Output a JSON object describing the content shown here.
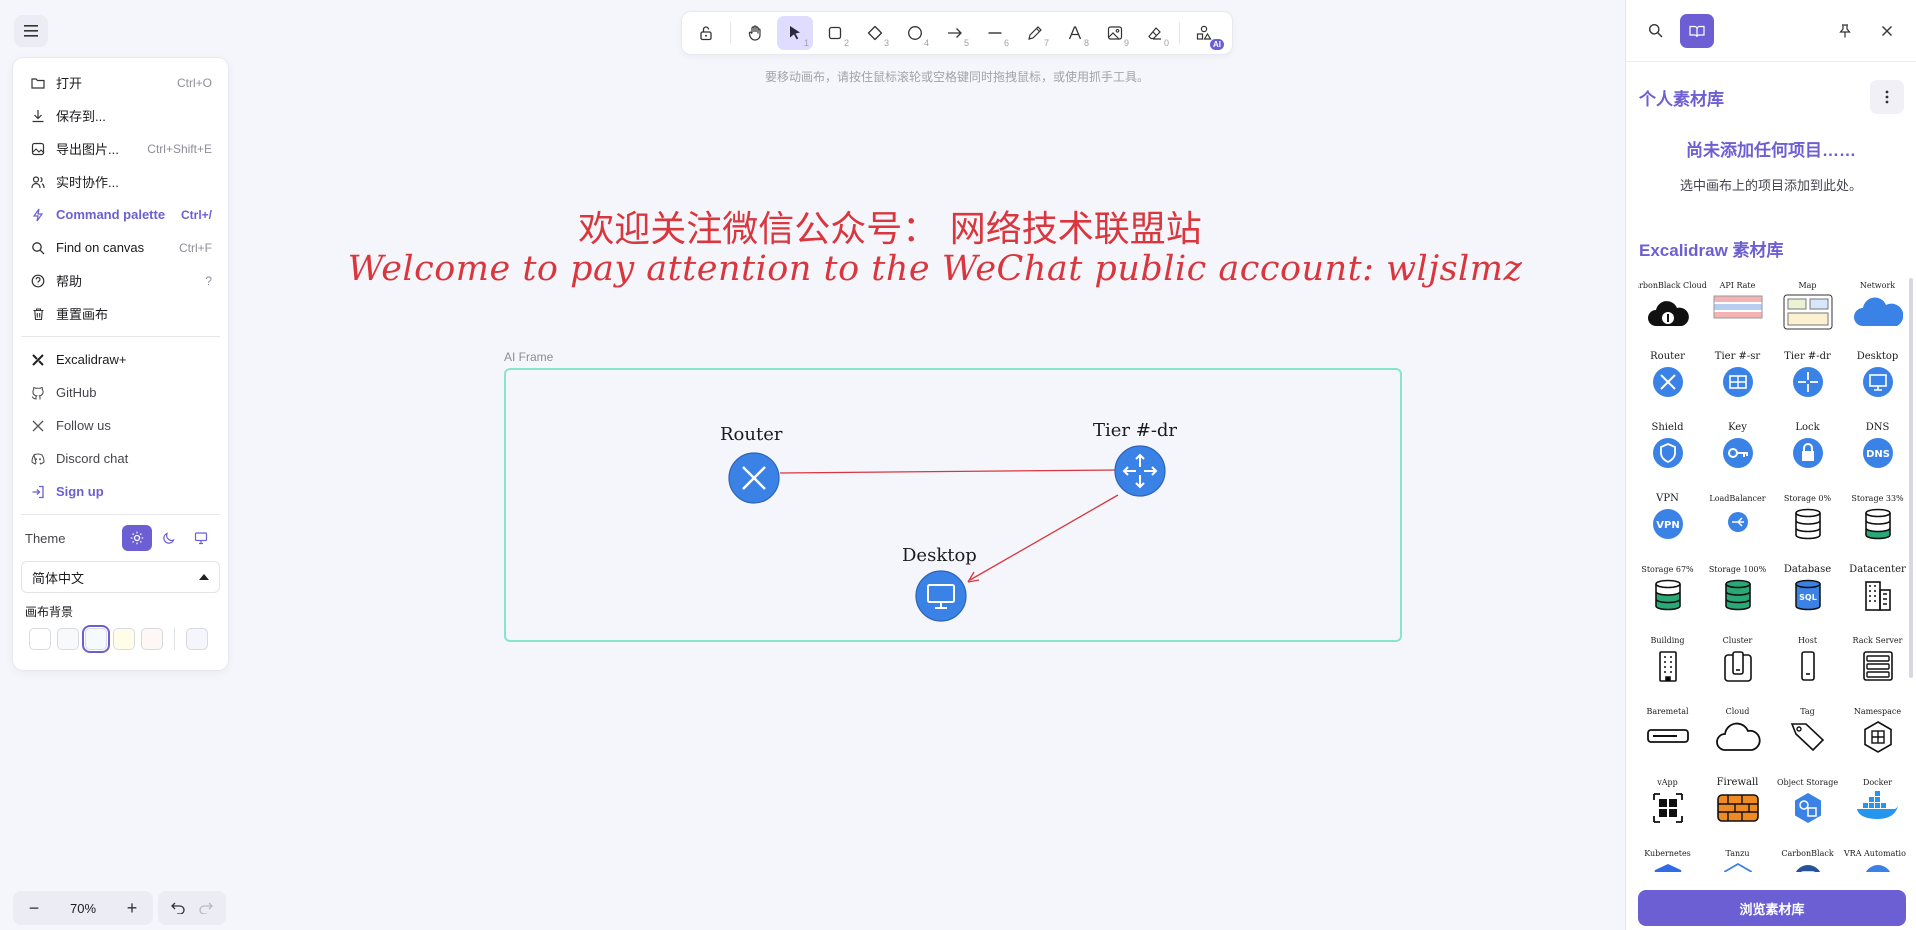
{
  "menu": {
    "items": [
      {
        "label": "打开",
        "shortcut": "Ctrl+O",
        "icon": "folder-icon"
      },
      {
        "label": "保存到...",
        "shortcut": "",
        "icon": "download-icon"
      },
      {
        "label": "导出图片...",
        "shortcut": "Ctrl+Shift+E",
        "icon": "export-image-icon"
      },
      {
        "label": "实时协作...",
        "shortcut": "",
        "icon": "users-icon"
      },
      {
        "label": "Command palette",
        "shortcut": "Ctrl+/",
        "icon": "bolt-icon"
      },
      {
        "label": "Find on canvas",
        "shortcut": "Ctrl+F",
        "icon": "search-icon"
      },
      {
        "label": "帮助",
        "shortcut": "?",
        "icon": "help-icon"
      },
      {
        "label": "重置画布",
        "shortcut": "",
        "icon": "trash-icon"
      }
    ],
    "links": [
      {
        "label": "Excalidraw+",
        "icon": "excalidraw-plus-icon"
      },
      {
        "label": "GitHub",
        "icon": "github-icon"
      },
      {
        "label": "Follow us",
        "icon": "x-logo-icon"
      },
      {
        "label": "Discord chat",
        "icon": "discord-icon"
      },
      {
        "label": "Sign up",
        "icon": "sign-up-icon"
      }
    ],
    "theme_label": "Theme",
    "language": "简体中文",
    "canvas_bg_label": "画布背景",
    "bg_swatches": [
      "#ffffff",
      "#f8f9fa",
      "#f5faff",
      "#fffce8",
      "#fdf8f6"
    ],
    "bg_custom": "#f5f6fb"
  },
  "toolbar": {
    "tools": [
      {
        "name": "lock",
        "key": ""
      },
      {
        "name": "hand",
        "key": ""
      },
      {
        "name": "selection",
        "key": "1"
      },
      {
        "name": "rectangle",
        "key": "2"
      },
      {
        "name": "diamond",
        "key": "3"
      },
      {
        "name": "ellipse",
        "key": "4"
      },
      {
        "name": "arrow",
        "key": "5"
      },
      {
        "name": "line",
        "key": "6"
      },
      {
        "name": "draw",
        "key": "7"
      },
      {
        "name": "text",
        "key": "8"
      },
      {
        "name": "image",
        "key": "9"
      },
      {
        "name": "eraser",
        "key": "0"
      }
    ],
    "ai_badge": "AI",
    "hint": "要移动画布，请按住鼠标滚轮或空格键同时拖拽鼠标，或使用抓手工具。"
  },
  "canvas": {
    "headline_cn": "欢迎关注微信公众号：   网络技术联盟站",
    "headline_en": "Welcome to pay attention to the WeChat public account: wljslmz",
    "frame_label": "AI Frame",
    "nodes": {
      "router": "Router",
      "tier": "Tier #-dr",
      "desktop": "Desktop"
    }
  },
  "zoom": {
    "value": "70%"
  },
  "library": {
    "personal_title": "个人素材库",
    "empty_title": "尚未添加任何项目……",
    "empty_desc": "选中画布上的项目添加到此处。",
    "excalidraw_title": "Excalidraw 素材库",
    "browse_label": "浏览素材库",
    "items": [
      "CarbonBlack Cloud",
      "API Rate",
      "Map",
      "Network",
      "Router",
      "Tier #-sr",
      "Tier #-dr",
      "Desktop",
      "Shield",
      "Key",
      "Lock",
      "DNS",
      "VPN",
      "LoadBalancer",
      "Storage 0%",
      "Storage 33%",
      "Storage 67%",
      "Storage 100%",
      "Database",
      "Datacenter",
      "Building",
      "Cluster",
      "Host",
      "Rack Server",
      "Baremetal",
      "Cloud",
      "Tag",
      "Namespace",
      "vApp",
      "Firewall",
      "Object Storage",
      "Docker",
      "Kubernetes",
      "Tanzu",
      "CarbonBlack",
      "VRA Automation"
    ]
  },
  "colors": {
    "accent": "#6c5fd3",
    "headline": "#d9363e",
    "node_blue": "#3b82e6",
    "frame": "#86e6cc"
  }
}
